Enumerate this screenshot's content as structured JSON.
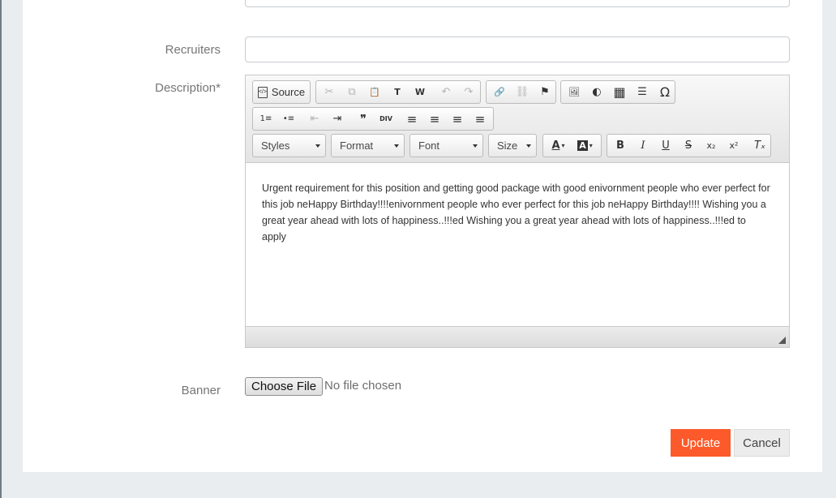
{
  "form": {
    "recruiters_label": "Recruiters",
    "recruiters_value": "",
    "description_label": "Description*",
    "banner_label": "Banner"
  },
  "editor": {
    "source_label": "Source",
    "combos": {
      "styles": "Styles",
      "format": "Format",
      "font": "Font",
      "size": "Size"
    },
    "glyphs": {
      "cut": "✂",
      "copy": "⧉",
      "paste": "📋",
      "paste_text": "T",
      "paste_word": "W",
      "undo": "↶",
      "redo": "↷",
      "link": "🔗",
      "unlink": "⛓",
      "anchor": "⚑",
      "image": "🖼",
      "flash": "◐",
      "table": "▦",
      "hr": "☰",
      "special_char": "Ω",
      "numbered_list": "1≡",
      "bulleted_list": "•≡",
      "outdent": "⇤",
      "indent": "⇥",
      "blockquote": "❞",
      "div": "DIV",
      "align_left": "≡",
      "align_center": "≡",
      "align_right": "≡",
      "justify": "≡",
      "text_color": "A",
      "bg_color": "A",
      "bold": "B",
      "italic": "I",
      "underline": "U",
      "strike": "S",
      "subscript": "x₂",
      "superscript": "x²",
      "remove_format": "Tₓ"
    },
    "content": "Urgent requirement for this position and getting good package with good enivornment people who ever perfect for this job neHappy Birthday!!!!enivornment people who ever perfect for this job neHappy Birthday!!!! Wishing you a great year ahead with lots of happiness..!!!ed Wishing you a great year ahead with lots of happiness..!!!ed to apply"
  },
  "banner": {
    "choose_file_label": "Choose File",
    "file_status": "No file chosen"
  },
  "actions": {
    "update_label": "Update",
    "cancel_label": "Cancel"
  },
  "colors": {
    "accent": "#fc5a2a",
    "page_bg": "#e9edf0"
  }
}
